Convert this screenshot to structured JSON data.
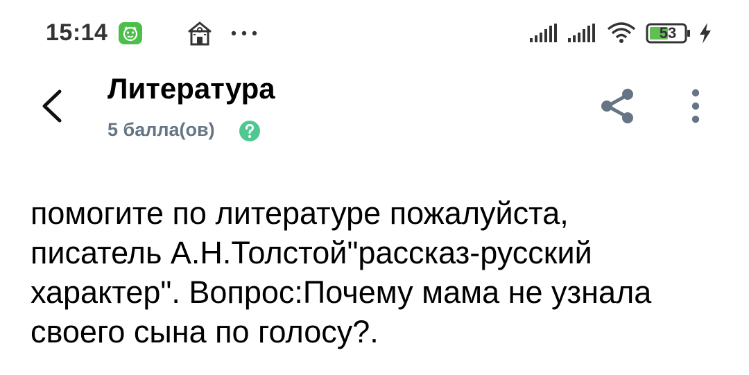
{
  "status_bar": {
    "time": "15:14",
    "app_badge_icon": "green-face-icon",
    "notification_icon": "house-icon",
    "more_icon": "ellipsis-icon",
    "signal_icons": [
      "signal-bars-icon",
      "signal-bars-icon"
    ],
    "wifi_icon": "wifi-icon",
    "battery_level": "53",
    "charging_icon": "bolt-icon",
    "colors": {
      "badge": "#4cbf4a",
      "battery_fill": "#5fc04f"
    }
  },
  "header": {
    "back_icon": "chevron-left-icon",
    "title": "Литература",
    "points": "5 балла(ов)",
    "help_icon": "question-circle-icon",
    "share_icon": "share-icon",
    "menu_icon": "more-vertical-icon",
    "colors": {
      "points_text": "#657585",
      "help": "#4fc88f",
      "action_icons": "#657585"
    }
  },
  "question": {
    "text": "помогите по литературе пожалуйста,\nписатель А.Н.Толстой\"рассказ-русский\nхарактер\". Вопрос:Почему мама не узнала\nсвоего сына по голосу?."
  }
}
